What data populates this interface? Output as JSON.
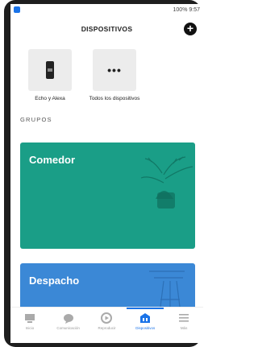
{
  "status": {
    "right_text": "100% 9:57"
  },
  "header": {
    "title": "DISPOSITIVOS",
    "add_symbol": "+"
  },
  "devices": [
    {
      "label": "Echo y Alexa",
      "icon": "echo-device-icon"
    },
    {
      "label": "Todos los dispositivos",
      "icon": "more-dots-icon",
      "glyph": "•••"
    }
  ],
  "groups": {
    "title": "GRUPOS",
    "items": [
      {
        "name": "Comedor",
        "color": "#1a9e87"
      },
      {
        "name": "Despacho",
        "color": "#3b88d6"
      }
    ]
  },
  "navbar": {
    "items": [
      {
        "label": "Inicio",
        "icon": "home-icon"
      },
      {
        "label": "Comunicación",
        "icon": "chat-icon"
      },
      {
        "label": "Reproducir",
        "icon": "play-icon"
      },
      {
        "label": "Dispositivos",
        "icon": "devices-icon",
        "active": true
      },
      {
        "label": "Más",
        "icon": "menu-icon"
      }
    ]
  },
  "colors": {
    "accent": "#1a73e8"
  }
}
